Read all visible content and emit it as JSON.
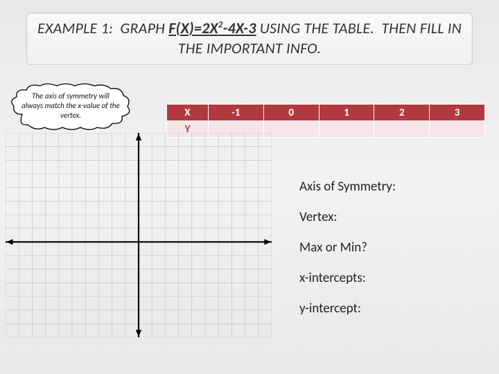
{
  "title": {
    "prefix": "EXAMPLE 1:  GRAPH ",
    "equation_html": "F(X)=2X<sup>2</sup>-4X-3",
    "suffix": " USING THE TABLE.  THEN FILL IN THE IMPORTANT INFO."
  },
  "cloud": {
    "text": "The axis of symmetry will always match the x-value of the vertex."
  },
  "table": {
    "row_label_x": "X",
    "row_label_y": "Y",
    "x_values": [
      "-1",
      "0",
      "1",
      "2",
      "3"
    ],
    "y_values": [
      "",
      "",
      "",
      "",
      ""
    ]
  },
  "grid": {
    "cols": 20,
    "rows": 15,
    "axis_x_at_row": 8,
    "axis_y_at_col": 10
  },
  "info": {
    "items": [
      "Axis of Symmetry:",
      "Vertex:",
      "Max or Min?",
      "x-intercepts:",
      "y-intercept:"
    ]
  }
}
